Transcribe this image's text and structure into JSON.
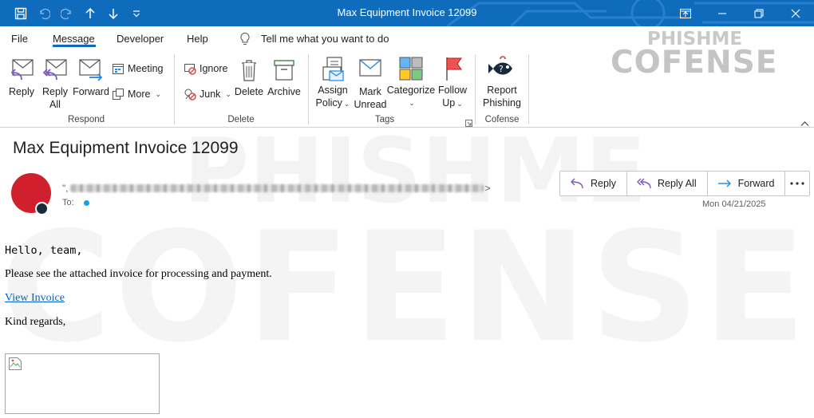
{
  "window": {
    "title": "Max Equipment Invoice 12099",
    "qat_icons": [
      "save-icon",
      "undo-icon",
      "redo-icon",
      "previous-item-icon",
      "next-item-icon",
      "customize-qat-icon"
    ],
    "controls": [
      "ribbon-display-icon",
      "minimize-icon",
      "restore-icon",
      "close-icon"
    ]
  },
  "tabs": [
    {
      "label": "File"
    },
    {
      "label": "Message",
      "active": true
    },
    {
      "label": "Developer"
    },
    {
      "label": "Help"
    }
  ],
  "tell_me": {
    "label": "Tell me what you want to do",
    "icon": "lightbulb-icon"
  },
  "ribbon": {
    "respond": {
      "label": "Respond",
      "reply": "Reply",
      "reply_all_1": "Reply",
      "reply_all_2": "All",
      "forward": "Forward",
      "meeting": "Meeting",
      "more": "More"
    },
    "delete": {
      "label": "Delete",
      "ignore": "Ignore",
      "junk": "Junk",
      "delete": "Delete",
      "archive": "Archive"
    },
    "tags": {
      "label": "Tags",
      "assign_1": "Assign",
      "assign_2": "Policy",
      "mark_1": "Mark",
      "mark_2": "Unread",
      "categorize": "Categorize",
      "follow_1": "Follow",
      "follow_2": "Up"
    },
    "cofense": {
      "label": "Cofense",
      "report_1": "Report",
      "report_2": "Phishing"
    }
  },
  "watermark": {
    "top": "PHISHME",
    "bottom": "COFENSE"
  },
  "message": {
    "subject": "Max Equipment Invoice 12099",
    "sender_open": "\",",
    "sender_close": ">",
    "to_label": "To:",
    "date": "Mon 04/21/2025",
    "actions": {
      "reply": "Reply",
      "reply_all": "Reply All",
      "forward": "Forward"
    },
    "colors": {
      "avatar": "#d0202e",
      "presence": "#1b2a3a",
      "accent": "#0f6cbd"
    }
  },
  "body": {
    "greeting": "Hello, team,",
    "line1": "Please see the attached invoice for processing and payment.",
    "link": "View Invoice",
    "closing": "Kind regards,"
  }
}
